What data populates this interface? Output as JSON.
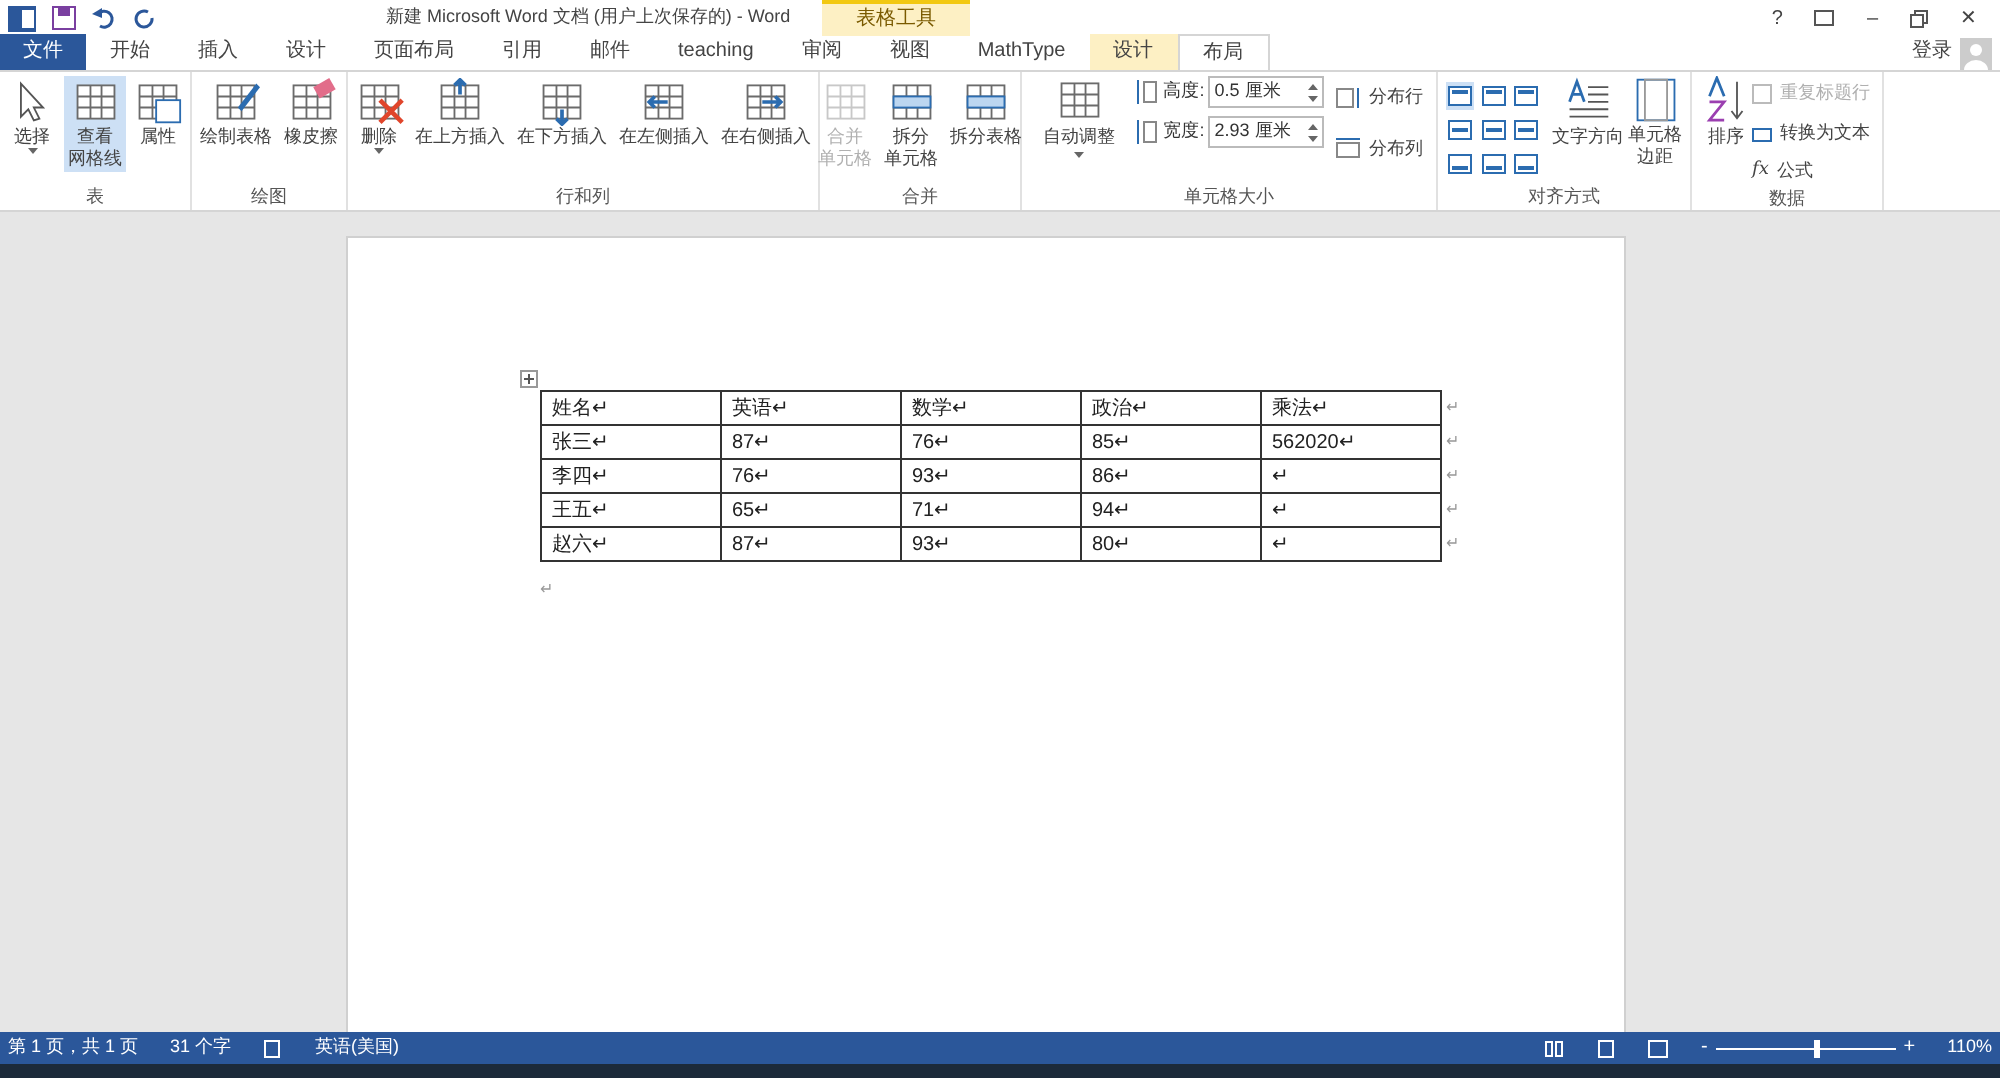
{
  "title_bar": {
    "title": "新建 Microsoft Word 文档 (用户上次保存的) - Word",
    "help": "?",
    "minimize": "–",
    "close": "✕"
  },
  "contextual": {
    "label": "表格工具"
  },
  "tabs": [
    {
      "label": "文件",
      "kind": "file",
      "selected": false
    },
    {
      "label": "开始",
      "kind": "tab",
      "selected": false
    },
    {
      "label": "插入",
      "kind": "tab",
      "selected": false
    },
    {
      "label": "设计",
      "kind": "tab",
      "selected": false
    },
    {
      "label": "页面布局",
      "kind": "tab",
      "selected": false
    },
    {
      "label": "引用",
      "kind": "tab",
      "selected": false
    },
    {
      "label": "邮件",
      "kind": "tab",
      "selected": false
    },
    {
      "label": "teaching",
      "kind": "tab",
      "selected": false
    },
    {
      "label": "审阅",
      "kind": "tab",
      "selected": false
    },
    {
      "label": "视图",
      "kind": "tab",
      "selected": false
    },
    {
      "label": "MathType",
      "kind": "tab",
      "selected": false
    },
    {
      "label": "设计",
      "kind": "context",
      "selected": false
    },
    {
      "label": "布局",
      "kind": "context",
      "selected": true
    }
  ],
  "sign_in": "登录",
  "groups": [
    {
      "name": "表",
      "items": [
        {
          "lines": [
            "选择"
          ],
          "selected": false,
          "disabled": false,
          "dropdown": true
        },
        {
          "lines": [
            "查看",
            "网格线"
          ],
          "selected": true,
          "disabled": false,
          "dropdown": false
        },
        {
          "lines": [
            "属性"
          ],
          "selected": false,
          "disabled": false,
          "dropdown": false
        }
      ]
    },
    {
      "name": "绘图",
      "items": [
        {
          "lines": [
            "绘制表格"
          ],
          "selected": false,
          "disabled": false,
          "dropdown": false
        },
        {
          "lines": [
            "橡皮擦"
          ],
          "selected": false,
          "disabled": false,
          "dropdown": false
        }
      ]
    },
    {
      "name": "行和列",
      "items": [
        {
          "lines": [
            "删除"
          ],
          "selected": false,
          "disabled": false,
          "dropdown": true
        },
        {
          "lines": [
            "在上方插入"
          ],
          "selected": false,
          "disabled": false,
          "dropdown": false
        },
        {
          "lines": [
            "在下方插入"
          ],
          "selected": false,
          "disabled": false,
          "dropdown": false
        },
        {
          "lines": [
            "在左侧插入"
          ],
          "selected": false,
          "disabled": false,
          "dropdown": false
        },
        {
          "lines": [
            "在右侧插入"
          ],
          "selected": false,
          "disabled": false,
          "dropdown": false
        }
      ]
    },
    {
      "name": "合并",
      "items": [
        {
          "lines": [
            "合并",
            "单元格"
          ],
          "selected": false,
          "disabled": true,
          "dropdown": false
        },
        {
          "lines": [
            "拆分",
            "单元格"
          ],
          "selected": false,
          "disabled": false,
          "dropdown": false
        },
        {
          "lines": [
            "拆分表格"
          ],
          "selected": false,
          "disabled": false,
          "dropdown": false
        }
      ]
    }
  ],
  "cell_size": {
    "name": "单元格大小",
    "autofit": "自动调整",
    "height_label": "高度:",
    "height": "0.5 厘米",
    "width_label": "宽度:",
    "width": "2.93 厘米",
    "distribute_rows": "分布行",
    "distribute_cols": "分布列"
  },
  "alignment": {
    "name": "对齐方式",
    "cells": [
      {
        "selected": true
      },
      {
        "selected": false
      },
      {
        "selected": false
      },
      {
        "selected": false
      },
      {
        "selected": false
      },
      {
        "selected": false
      },
      {
        "selected": false
      },
      {
        "selected": false
      },
      {
        "selected": false
      }
    ],
    "text_direction": "文字方向",
    "margins": [
      "单元格",
      "边距"
    ]
  },
  "data": {
    "name": "数据",
    "sort": "排序",
    "repeat_header": "重复标题行",
    "repeat_disabled": true,
    "convert": "转换为文本",
    "formula_icon": "fx",
    "formula": "公式"
  },
  "table": {
    "rows": [
      [
        "姓名↵",
        "英语↵",
        "数学↵",
        "政治↵",
        "乘法↵"
      ],
      [
        "张三↵",
        "87↵",
        "76↵",
        "85↵",
        "562020↵"
      ],
      [
        "李四↵",
        "76↵",
        "93↵",
        "86↵",
        "↵"
      ],
      [
        "王五↵",
        "65↵",
        "71↵",
        "94↵",
        "↵"
      ],
      [
        "赵六↵",
        "87↵",
        "93↵",
        "80↵",
        "↵"
      ]
    ],
    "row_end": "↵",
    "after": "↵"
  },
  "status_bar": {
    "page": "第 1 页，共 1 页",
    "words": "31 个字",
    "language": "英语(美国)",
    "zoom_out": "-",
    "zoom_slider": {
      "level": 0.55
    },
    "zoom_in": "+",
    "zoom": "110%"
  }
}
